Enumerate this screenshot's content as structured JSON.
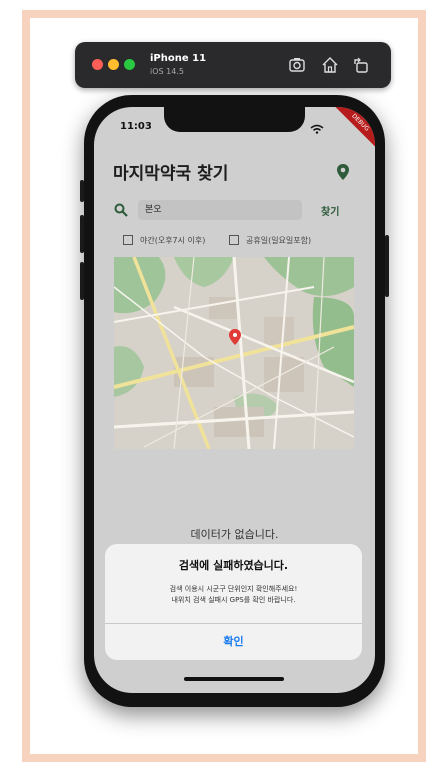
{
  "simulator": {
    "device": "iPhone 11",
    "os": "iOS 14.5"
  },
  "status": {
    "time": "11:03",
    "debug_banner": "DEBUG"
  },
  "app": {
    "title": "마지막약국 찾기",
    "search": {
      "value": "본오",
      "button": "찾기"
    },
    "filters": [
      {
        "label": "야간(오후7시 이후)",
        "checked": false
      },
      {
        "label": "공휴일(일요일포함)",
        "checked": false
      }
    ],
    "empty_text": "데이터가 없습니다."
  },
  "dialog": {
    "title": "검색에 실패하였습니다.",
    "line1": "검색 이용시 시군구 단위인지 확인해주세요!",
    "line2": "내위치 검색 실패시 GPS를 확인 바랍니다.",
    "confirm": "확인"
  },
  "colors": {
    "accent_green": "#2e5b3a",
    "dialog_button": "#1b7cf0",
    "frame": "#f6d2bf"
  }
}
